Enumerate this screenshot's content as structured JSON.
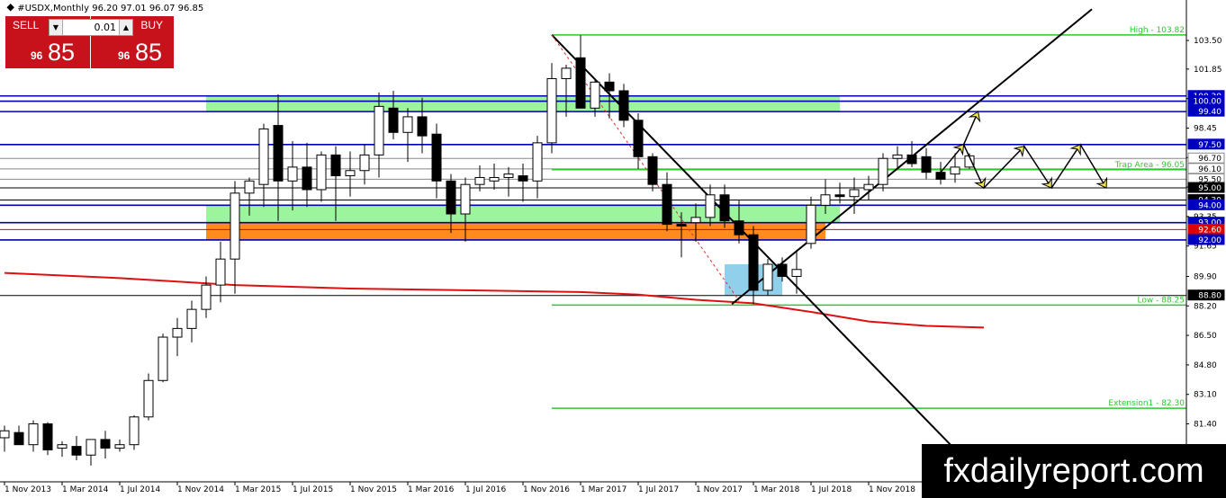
{
  "header": {
    "symbol": "#USDX,Monthly",
    "ohlc": "96.20 97.01 96.07 96.85"
  },
  "trade": {
    "sell_label": "SELL",
    "buy_label": "BUY",
    "lot": "0.01",
    "sell_small": "96",
    "sell_big": "85",
    "buy_small": "96",
    "buy_big": "85",
    "lot_down_icon": "triangle-down",
    "lot_up_icon": "triangle-up"
  },
  "watermark": "fxdailyreport.com",
  "colors": {
    "bull": "#ffffff",
    "bear": "#000000",
    "ma": "#e01010",
    "level_blue": "#0000b0",
    "fib_green": "#2dc82d",
    "zone_green": "#9cf59c",
    "zone_orange": "#ff8a1e",
    "zone_blue": "#7ec8e8",
    "tag_red": "#e00000",
    "tag_blue": "#0000c0"
  },
  "chart_data": {
    "type": "candlestick",
    "title": "#USDX,Monthly",
    "x_tick_labels": [
      "1 Nov 2013",
      "1 Mar 2014",
      "1 Jul 2014",
      "1 Nov 2014",
      "1 Mar 2015",
      "1 Jul 2015",
      "1 Nov 2015",
      "1 Mar 2016",
      "1 Jul 2016",
      "1 Nov 2016",
      "1 Mar 2017",
      "1 Jul 2017",
      "1 Nov 2017",
      "1 Mar 2018",
      "1 Jul 2018",
      "1 Nov 2018"
    ],
    "y_tick_labels": [
      "103.50",
      "101.85",
      "100.15",
      "98.45",
      "96.75",
      "95.05",
      "93.35",
      "91.65",
      "89.90",
      "88.20",
      "86.50",
      "84.80",
      "83.10",
      "81.40"
    ],
    "ylim": [
      80.3,
      105.2
    ],
    "candles": [
      [
        80.6,
        81.3,
        79.8,
        81.0
      ],
      [
        80.9,
        81.3,
        80.3,
        80.2
      ],
      [
        80.2,
        81.6,
        79.8,
        81.4
      ],
      [
        81.4,
        81.5,
        79.6,
        79.9
      ],
      [
        80.0,
        80.4,
        79.5,
        80.2
      ],
      [
        80.1,
        80.7,
        79.3,
        79.6
      ],
      [
        79.6,
        80.5,
        79.0,
        80.5
      ],
      [
        80.5,
        81.0,
        79.4,
        80.0
      ],
      [
        80.0,
        80.5,
        79.8,
        80.2
      ],
      [
        80.2,
        81.9,
        79.9,
        81.8
      ],
      [
        81.8,
        84.3,
        81.6,
        83.9
      ],
      [
        83.9,
        86.6,
        83.8,
        86.4
      ],
      [
        86.4,
        87.5,
        85.3,
        86.9
      ],
      [
        86.9,
        88.5,
        86.1,
        88.0
      ],
      [
        88.0,
        89.9,
        87.5,
        89.4
      ],
      [
        89.4,
        91.9,
        88.4,
        90.9
      ],
      [
        90.9,
        95.4,
        88.9,
        94.7
      ],
      [
        94.7,
        95.6,
        93.4,
        95.4
      ],
      [
        95.2,
        98.7,
        93.9,
        98.4
      ],
      [
        98.6,
        100.4,
        93.1,
        95.4
      ],
      [
        95.4,
        97.7,
        93.7,
        96.2
      ],
      [
        96.2,
        97.6,
        93.9,
        94.9
      ],
      [
        94.9,
        97.1,
        94.2,
        96.9
      ],
      [
        96.9,
        97.4,
        93.1,
        95.7
      ],
      [
        95.7,
        97.1,
        94.5,
        96.0
      ],
      [
        96.0,
        97.5,
        95.2,
        96.9
      ],
      [
        96.9,
        100.5,
        95.6,
        99.7
      ],
      [
        99.6,
        100.6,
        97.8,
        98.2
      ],
      [
        98.2,
        99.6,
        96.5,
        99.1
      ],
      [
        99.1,
        100.2,
        97.0,
        98.0
      ],
      [
        98.1,
        98.7,
        94.4,
        95.4
      ],
      [
        95.4,
        95.8,
        92.4,
        93.5
      ],
      [
        93.5,
        95.6,
        91.9,
        95.2
      ],
      [
        95.2,
        96.3,
        94.8,
        95.6
      ],
      [
        95.4,
        96.4,
        94.9,
        95.6
      ],
      [
        95.6,
        96.2,
        94.5,
        95.8
      ],
      [
        95.7,
        96.4,
        94.2,
        95.4
      ],
      [
        95.4,
        98.0,
        94.4,
        97.6
      ],
      [
        97.6,
        102.2,
        97.0,
        101.3
      ],
      [
        101.3,
        102.1,
        99.1,
        101.9
      ],
      [
        102.5,
        103.8,
        100.2,
        99.6
      ],
      [
        99.6,
        101.2,
        99.1,
        101.1
      ],
      [
        101.1,
        101.6,
        99.0,
        100.6
      ],
      [
        100.6,
        101.0,
        98.5,
        98.9
      ],
      [
        98.9,
        99.3,
        96.1,
        96.8
      ],
      [
        96.8,
        97.0,
        94.8,
        95.2
      ],
      [
        95.2,
        95.9,
        92.5,
        92.9
      ],
      [
        92.9,
        93.6,
        91.0,
        92.8
      ],
      [
        93.0,
        94.1,
        91.9,
        93.3
      ],
      [
        93.3,
        95.2,
        92.8,
        94.6
      ],
      [
        94.6,
        95.2,
        92.7,
        93.1
      ],
      [
        93.1,
        94.3,
        91.8,
        92.3
      ],
      [
        92.3,
        92.8,
        88.3,
        89.1
      ],
      [
        89.1,
        90.9,
        88.8,
        90.6
      ],
      [
        90.6,
        91.0,
        89.6,
        89.9
      ],
      [
        89.9,
        91.4,
        88.9,
        90.3
      ],
      [
        91.8,
        94.5,
        91.5,
        94.0
      ],
      [
        94.0,
        95.5,
        93.5,
        94.6
      ],
      [
        94.6,
        95.3,
        94.1,
        94.5
      ],
      [
        94.5,
        95.6,
        93.5,
        94.9
      ],
      [
        94.9,
        95.7,
        94.3,
        95.2
      ],
      [
        95.2,
        97.0,
        94.8,
        96.7
      ],
      [
        96.7,
        97.4,
        96.1,
        96.9
      ],
      [
        96.9,
        97.7,
        96.2,
        96.4
      ],
      [
        96.8,
        97.3,
        95.5,
        95.9
      ],
      [
        95.9,
        96.5,
        95.2,
        95.5
      ],
      [
        95.8,
        97.0,
        95.3,
        96.2
      ],
      [
        96.2,
        97.0,
        96.1,
        96.85
      ]
    ],
    "ma_series": [
      [
        0,
        90.1
      ],
      [
        8,
        89.8
      ],
      [
        16,
        89.4
      ],
      [
        24,
        89.2
      ],
      [
        32,
        89.1
      ],
      [
        40,
        89.0
      ],
      [
        44,
        88.85
      ],
      [
        48,
        88.55
      ],
      [
        52,
        88.35
      ],
      [
        56,
        87.85
      ],
      [
        60,
        87.3
      ],
      [
        64,
        87.05
      ],
      [
        68,
        86.95
      ]
    ],
    "h_levels": [
      {
        "value": 100.3,
        "label": "100.30",
        "color": "#0000b0"
      },
      {
        "value": 100.0,
        "label": "100.00",
        "color": "#0000b0"
      },
      {
        "value": 99.4,
        "label": "99.40",
        "color": "#0000b0"
      },
      {
        "value": 97.5,
        "label": "97.50",
        "color": "#0000b0"
      },
      {
        "value": 96.7,
        "label": "96.70",
        "color": "#888888"
      },
      {
        "value": 96.1,
        "label": "96.10",
        "color": "#888888"
      },
      {
        "value": 95.5,
        "label": "95.50",
        "color": "#888888"
      },
      {
        "value": 95.0,
        "label": "95.00",
        "color": "#000000"
      },
      {
        "value": 94.3,
        "label": "94.30",
        "color": "#000000"
      },
      {
        "value": 94.0,
        "label": "94.00",
        "color": "#0000b0"
      },
      {
        "value": 93.0,
        "label": "93.00",
        "color": "#0000b0"
      },
      {
        "value": 92.6,
        "label": "92.60",
        "color": "#e00000"
      },
      {
        "value": 92.0,
        "label": "92.00",
        "color": "#0000b0"
      },
      {
        "value": 88.8,
        "label": "88.80",
        "color": "#000000"
      }
    ],
    "fib_lines": [
      {
        "value": 103.82,
        "label": "High - 103.82"
      },
      {
        "value": 96.05,
        "label": "Trap Area - 96.05"
      },
      {
        "value": 88.25,
        "label": "Low - 88.25"
      },
      {
        "value": 82.3,
        "label": "Extension1 - 82.30"
      }
    ],
    "zones": [
      {
        "name": "zone-green-top",
        "from_x": 14,
        "to_x": 58,
        "low": 99.4,
        "high": 100.3,
        "color": "#9cf59c"
      },
      {
        "name": "zone-green-mid",
        "from_x": 14,
        "to_x": 58,
        "low": 93.0,
        "high": 94.0,
        "color": "#9cf59c"
      },
      {
        "name": "zone-orange",
        "from_x": 14,
        "to_x": 57,
        "low": 92.0,
        "high": 93.0,
        "color": "#ff8a1e"
      },
      {
        "name": "zone-blue",
        "from_x": 50,
        "to_x": 54,
        "low": 88.8,
        "high": 90.6,
        "color": "#7ec8e8"
      }
    ],
    "trendlines": [
      {
        "x1": 38,
        "y1": 103.82,
        "x2": 66.5,
        "y2": 79.5,
        "color": "#000000"
      },
      {
        "x1": 50.5,
        "y1": 88.3,
        "x2": 75.5,
        "y2": 105.3,
        "color": "#000000"
      },
      {
        "x1": 38,
        "y1": 103.82,
        "x2": 51,
        "y2": 88.5,
        "color": "#e03030",
        "dash": true
      }
    ],
    "forecast_path": [
      [
        65,
        95.9
      ],
      [
        66.6,
        97.5
      ],
      [
        68,
        95.0
      ],
      [
        70.8,
        97.4
      ],
      [
        72.7,
        95.0
      ],
      [
        74.7,
        97.5
      ],
      [
        76.5,
        95.0
      ]
    ],
    "forecast_up": [
      [
        66.6,
        97.5
      ],
      [
        67.6,
        99.4
      ]
    ],
    "last_price": 96.85,
    "grid": false,
    "legend": "none"
  }
}
